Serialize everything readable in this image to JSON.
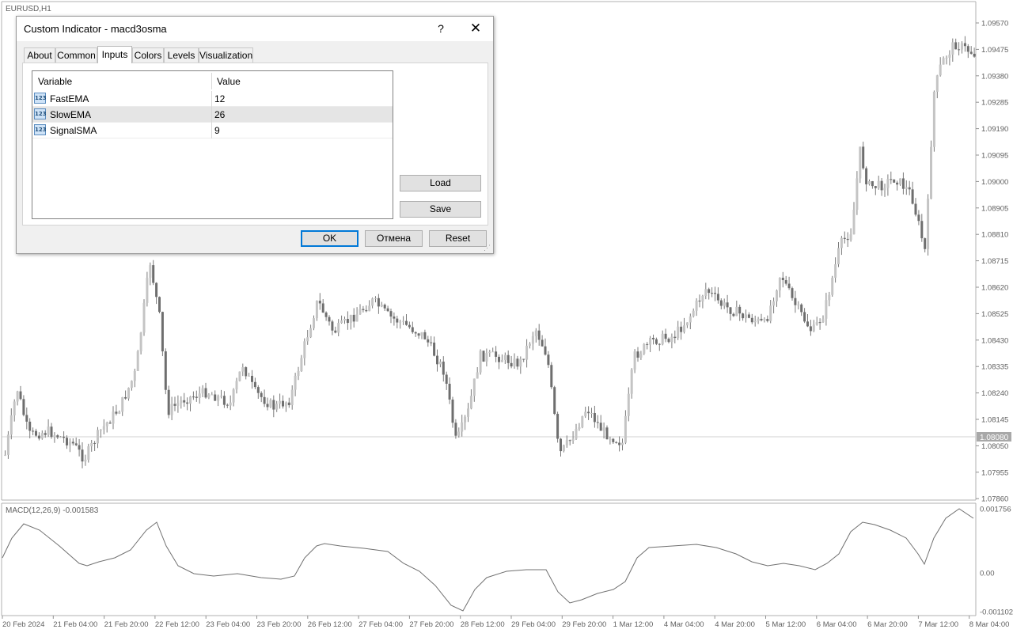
{
  "chart": {
    "symbol_label": "EURUSD,H1",
    "current_price": "1.08080",
    "price_labels": [
      "1.09570",
      "1.09475",
      "1.09380",
      "1.09285",
      "1.09190",
      "1.09095",
      "1.09000",
      "1.08905",
      "1.08810",
      "1.08715",
      "1.08620",
      "1.08525",
      "1.08430",
      "1.08335",
      "1.08240",
      "1.08145",
      "1.08050",
      "1.07955",
      "1.07860"
    ],
    "time_labels": [
      "20 Feb 2024",
      "21 Feb 04:00",
      "21 Feb 20:00",
      "22 Feb 12:00",
      "23 Feb 04:00",
      "23 Feb 20:00",
      "26 Feb 12:00",
      "27 Feb 04:00",
      "27 Feb 20:00",
      "28 Feb 12:00",
      "29 Feb 04:00",
      "29 Feb 20:00",
      "1 Mar 12:00",
      "4 Mar 04:00",
      "4 Mar 20:00",
      "5 Mar 12:00",
      "6 Mar 04:00",
      "6 Mar 20:00",
      "7 Mar 12:00",
      "8 Mar 04:00"
    ],
    "macd_label": "MACD(12,26,9) -0.001583",
    "macd_scale": [
      "0.001756",
      "0.00",
      "-0.001102"
    ],
    "colors": {
      "candle": "#6e6e6e",
      "grid_line": "#c8c8c8",
      "price_tag_bg": "#a8a8a8",
      "text": "#606060"
    }
  },
  "dialog": {
    "title": "Custom Indicator - macd3osma",
    "help": "?",
    "close": "✕",
    "tabs": [
      "About",
      "Common",
      "Inputs",
      "Colors",
      "Levels",
      "Visualization"
    ],
    "active_tab": "Inputs",
    "grid": {
      "col_variable": "Variable",
      "col_value": "Value",
      "rows": [
        {
          "name": "FastEMA",
          "value": "12",
          "icon": "123"
        },
        {
          "name": "SlowEMA",
          "value": "26",
          "icon": "123"
        },
        {
          "name": "SignalSMA",
          "value": "9",
          "icon": "123"
        }
      ]
    },
    "buttons": {
      "load": "Load",
      "save": "Save",
      "ok": "OK",
      "cancel": "Отмена",
      "reset": "Reset"
    }
  }
}
